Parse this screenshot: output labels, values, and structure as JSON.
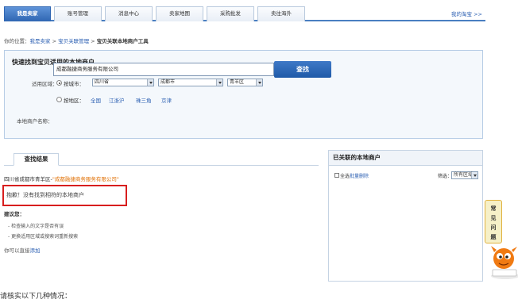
{
  "nav": {
    "tabs": [
      {
        "label": "我是卖家",
        "active": true
      },
      {
        "label": "账号管理",
        "active": false
      },
      {
        "label": "消息中心",
        "active": false
      },
      {
        "label": "卖家地图",
        "active": false
      },
      {
        "label": "采购批发",
        "active": false
      },
      {
        "label": "卖往海外",
        "active": false
      }
    ],
    "my_taobao": "我的淘宝 >>"
  },
  "breadcrumb": {
    "prefix": "你的位置：",
    "items": [
      "我是卖家",
      "宝贝关联管理",
      "宝贝关联本地商户工具"
    ],
    "sep": " > "
  },
  "search": {
    "title": "快速找到宝贝适用的本地商户",
    "region_label": "适用区域：",
    "by_city_label": "按城市：",
    "province": "四川省",
    "city": "成都市",
    "district": "青羊区",
    "by_area_label": "按地区：",
    "areas": [
      "全国",
      "江浙沪",
      "珠三角",
      "京津"
    ],
    "merchant_label": "本地商户名称：",
    "merchant_value": "成都融捷商务服务有限公司",
    "button": "查找"
  },
  "results": {
    "tab": "查找结果",
    "location": "四川省成都市青羊区-",
    "query": "\"成都融捷商务服务有限公司\"",
    "not_found": "抱歉！没有找到相符的本地商户",
    "advice_title": "建议您：",
    "advice": [
      "- 检查输入的文字是否有误",
      "- 更换适用区域或搜索词重新搜索"
    ],
    "direct_prefix": "你可以直接",
    "direct_link": "添加"
  },
  "linked": {
    "title": "已关联的本地商户",
    "select_all": "全选",
    "batch_delete": "批量删除",
    "filter_label": "筛选：",
    "filter_value": "所有区域"
  },
  "faq": {
    "chars": [
      "常",
      "见",
      "问",
      "题"
    ]
  },
  "footer_text": "请核实以下几种情况："
}
